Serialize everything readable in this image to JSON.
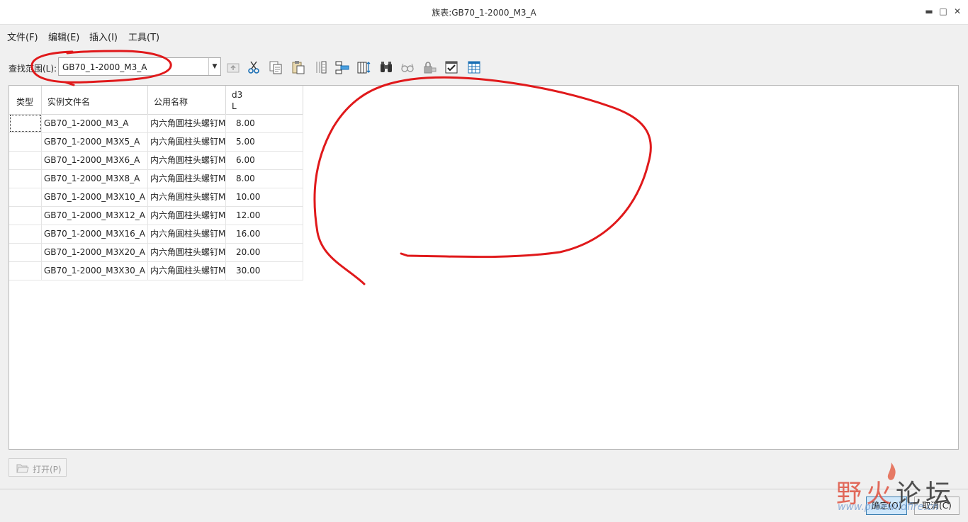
{
  "window": {
    "title": "族表:GB70_1-2000_M3_A",
    "minimize_glyph": "▬",
    "maximize_glyph": "□",
    "close_glyph": "✕"
  },
  "menu": [
    {
      "label": "文件(F)"
    },
    {
      "label": "编辑(E)"
    },
    {
      "label": "插入(I)"
    },
    {
      "label": "工具(T)"
    }
  ],
  "lookin": {
    "label": "查找范围(L):",
    "value": "GB70_1-2000_M3_A",
    "arrow": "▼"
  },
  "toolbar_icons": [
    "up-level-icon",
    "cut-icon",
    "copy-icon",
    "paste-icon",
    "insert-column-icon",
    "insert-row-icon",
    "column-settings-icon",
    "find-icon",
    "show-icon",
    "lock-icon",
    "verify-icon",
    "table-icon"
  ],
  "table": {
    "headers": {
      "type": "类型",
      "instance_name": "实例文件名",
      "common_name": "公用名称",
      "dim_line1": "d3",
      "dim_line2": "L"
    },
    "rows": [
      {
        "type": "",
        "instance": "GB70_1-2000_M3_A",
        "common": "内六角圆柱头螺钉M",
        "d3": "8.00"
      },
      {
        "type": "",
        "instance": "GB70_1-2000_M3X5_A",
        "common": "内六角圆柱头螺钉M",
        "d3": "5.00"
      },
      {
        "type": "",
        "instance": "GB70_1-2000_M3X6_A",
        "common": "内六角圆柱头螺钉M",
        "d3": "6.00"
      },
      {
        "type": "",
        "instance": "GB70_1-2000_M3X8_A",
        "common": "内六角圆柱头螺钉M",
        "d3": "8.00"
      },
      {
        "type": "",
        "instance": "GB70_1-2000_M3X10_A",
        "common": "内六角圆柱头螺钉M",
        "d3": "10.00"
      },
      {
        "type": "",
        "instance": "GB70_1-2000_M3X12_A",
        "common": "内六角圆柱头螺钉M",
        "d3": "12.00"
      },
      {
        "type": "",
        "instance": "GB70_1-2000_M3X16_A",
        "common": "内六角圆柱头螺钉M",
        "d3": "16.00"
      },
      {
        "type": "",
        "instance": "GB70_1-2000_M3X20_A",
        "common": "内六角圆柱头螺钉M",
        "d3": "20.00"
      },
      {
        "type": "",
        "instance": "GB70_1-2000_M3X30_A",
        "common": "内六角圆柱头螺钉M",
        "d3": "30.00"
      }
    ]
  },
  "open_button": {
    "label": "打开(P)"
  },
  "ok_button": {
    "label": "确定(O)"
  },
  "cancel_button": {
    "label": "取消(C)"
  },
  "watermark": {
    "text_a": "野",
    "text_b": "火",
    "text_c": "论坛",
    "url": "www.proewildfire.cn"
  },
  "colors": {
    "annotation": "#e0191b",
    "ok_bg": "#cfe7fa",
    "accent": "#1a6fb5"
  }
}
